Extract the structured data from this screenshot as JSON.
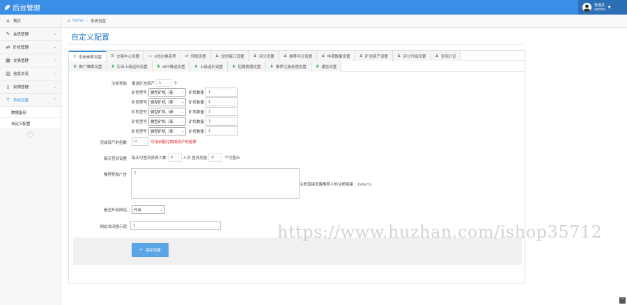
{
  "app": {
    "title": "后台管理",
    "user_name": "管理员",
    "user_role": "admin"
  },
  "sidebar": {
    "items": [
      {
        "label": "首页",
        "icon": "dashboard-icon"
      },
      {
        "label": "会员管理",
        "icon": "edit-icon"
      },
      {
        "label": "矿机管理",
        "icon": "shuffle-icon"
      },
      {
        "label": "交易管理",
        "icon": "grid-icon"
      },
      {
        "label": "信息交流",
        "icon": "chart-icon"
      },
      {
        "label": "权限管理",
        "icon": "document-icon"
      },
      {
        "label": "系统设置",
        "icon": "text-icon"
      }
    ],
    "sub_items": [
      {
        "label": "数据备份"
      },
      {
        "label": "自定义配置"
      }
    ]
  },
  "breadcrumb": {
    "home": "Home",
    "current": "系统设置"
  },
  "page": {
    "title": "自定义配置"
  },
  "tabs": {
    "row1": [
      {
        "label": "系统参数设置"
      },
      {
        "label": "交易中心设置"
      },
      {
        "label": "K线价格走势"
      },
      {
        "label": "转账设置"
      },
      {
        "label": "短信接口设置"
      },
      {
        "label": "评分设置"
      },
      {
        "label": "推荐评分设置"
      },
      {
        "label": "申请数量设置"
      },
      {
        "label": "矿池资产设置"
      },
      {
        "label": "评分升级设置"
      },
      {
        "label": "全网计证"
      }
    ],
    "row2": [
      {
        "label": "推广赚果设置"
      },
      {
        "label": "实币上级返利设置"
      },
      {
        "label": "APP推送设置"
      },
      {
        "label": "上级返利设置"
      },
      {
        "label": "招募数据设置"
      },
      {
        "label": "推荐注册处理设置"
      },
      {
        "label": "通告设置"
      }
    ]
  },
  "form": {
    "register_gift": {
      "label": "注册奖励",
      "prefix": "赠送矿池资产",
      "count_value": "1",
      "count_unit": "个",
      "rows": [
        {
          "type_label": "矿机型号",
          "select": "微型矿机（新",
          "qty_label": "矿机数量",
          "qty": "1"
        },
        {
          "type_label": "矿机型号",
          "select": "微型矿机（新",
          "qty_label": "矿机数量",
          "qty": "1"
        },
        {
          "type_label": "矿机型号",
          "select": "微型矿机（新",
          "qty_label": "矿机数量",
          "qty": "1"
        },
        {
          "type_label": "矿机型号",
          "select": "微型矿机（新",
          "qty_label": "矿机数量",
          "qty": "1"
        },
        {
          "type_label": "矿机型号",
          "select": "微型矿机（新",
          "qty_label": "矿机数量",
          "qty": "1"
        }
      ]
    },
    "complete_count": {
      "label": "完成资产的倍数",
      "value": "0",
      "hint": "可用余额兑换成资产的倍数"
    },
    "signin": {
      "label": "每天签到设置",
      "text1": "每天可签到获得人数",
      "value1": "0",
      "text2": "人次 签到奖励",
      "value2": "0",
      "text3": "个可售币"
    },
    "ad": {
      "label": "推荐奖励广告",
      "value": "2",
      "note": "注册直接设置推荐人的注册链接：{sdurl}"
    },
    "site_open": {
      "label": "是否开启网站",
      "value": "开启"
    },
    "site_close_msg": {
      "label": "网站关闭提示语",
      "value": "1"
    },
    "save_label": "保存设置"
  },
  "watermark": "https://www.huzhan.com/ishop35712"
}
